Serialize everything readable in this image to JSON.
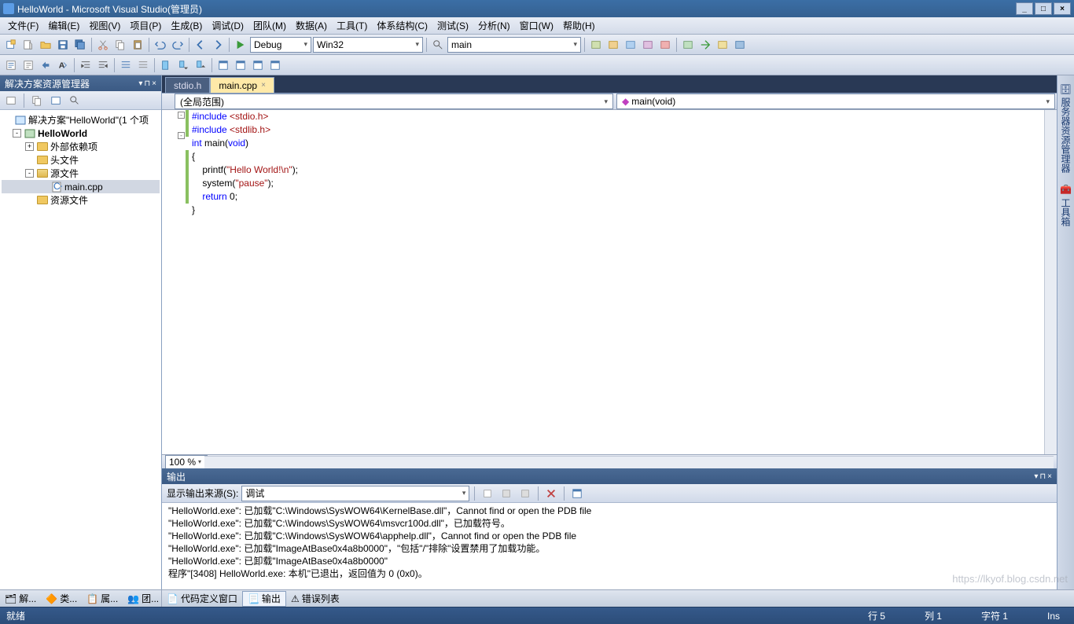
{
  "title": "HelloWorld - Microsoft Visual Studio(管理员)",
  "menu": [
    "文件(F)",
    "编辑(E)",
    "视图(V)",
    "项目(P)",
    "生成(B)",
    "调试(D)",
    "团队(M)",
    "数据(A)",
    "工具(T)",
    "体系结构(C)",
    "测试(S)",
    "分析(N)",
    "窗口(W)",
    "帮助(H)"
  ],
  "toolbar": {
    "config": "Debug",
    "platform": "Win32",
    "findbox": "main"
  },
  "solution": {
    "panel_title": "解决方案资源管理器",
    "root": "解决方案\"HelloWorld\"(1 个项",
    "project": "HelloWorld",
    "nodes": {
      "ext": "外部依赖项",
      "hdr": "头文件",
      "src": "源文件",
      "srcfile": "main.cpp",
      "res": "资源文件"
    }
  },
  "left_tabs": [
    "解...",
    "类...",
    "属...",
    "团..."
  ],
  "editor": {
    "tabs": [
      {
        "label": "stdio.h",
        "active": false
      },
      {
        "label": "main.cpp",
        "active": true
      }
    ],
    "scope_left": "(全局范围)",
    "scope_right": "main(void)",
    "zoom": "100 %",
    "code": {
      "l1a": "#include ",
      "l1b": "<stdio.h>",
      "l2a": "#include ",
      "l2b": "<stdlib.h>",
      "l3a": "int",
      "l3b": " main(",
      "l3c": "void",
      "l3d": ")",
      "l4": "{",
      "l5a": "    printf(",
      "l5b": "\"Hello World!\\n\"",
      "l5c": ");",
      "l6a": "    system(",
      "l6b": "\"pause\"",
      "l6c": ");",
      "l7a": "    ",
      "l7b": "return",
      "l7c": " 0;",
      "l8": "}"
    }
  },
  "output": {
    "title": "输出",
    "src_label": "显示输出来源(S):",
    "src_value": "调试",
    "lines": [
      "\"HelloWorld.exe\": 已加载\"C:\\Windows\\SysWOW64\\KernelBase.dll\"，Cannot find or open the PDB file",
      "\"HelloWorld.exe\": 已加载\"C:\\Windows\\SysWOW64\\msvcr100d.dll\"，已加载符号。",
      "\"HelloWorld.exe\": 已加载\"C:\\Windows\\SysWOW64\\apphelp.dll\"，Cannot find or open the PDB file",
      "\"HelloWorld.exe\": 已加载\"ImageAtBase0x4a8b0000\"，\"包括\"/\"排除\"设置禁用了加载功能。",
      "\"HelloWorld.exe\": 已卸载\"ImageAtBase0x4a8b0000\"",
      "程序\"[3408] HelloWorld.exe: 本机\"已退出，返回值为 0 (0x0)。"
    ]
  },
  "bottom_tabs": [
    "代码定义窗口",
    "输出",
    "错误列表"
  ],
  "right_tabs": [
    "服务器资源管理器",
    "工具箱"
  ],
  "status": {
    "ready": "就绪",
    "line": "行 5",
    "col": "列 1",
    "ch": "字符 1",
    "ins": "Ins"
  },
  "watermark": "https://lkyof.blog.csdn.net"
}
